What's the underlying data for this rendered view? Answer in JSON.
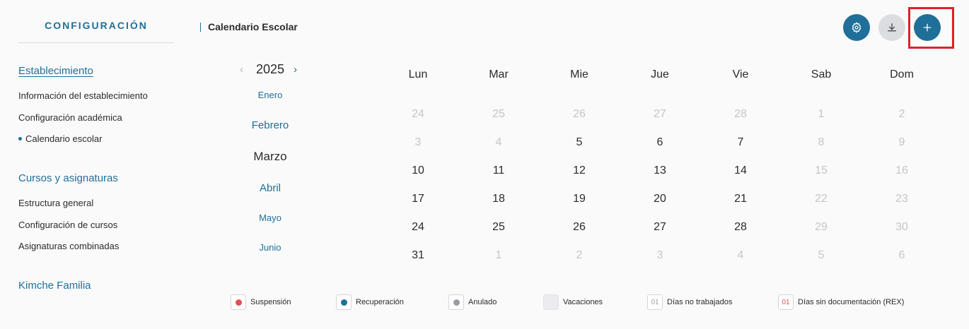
{
  "sidebar": {
    "title": "CONFIGURACIÓN",
    "sections": [
      {
        "heading": "Establecimiento",
        "items": [
          "Información del establecimiento",
          "Configuración académica",
          "Calendario escolar"
        ]
      },
      {
        "heading": "Cursos y asignaturas",
        "items": [
          "Estructura general",
          "Configuración de cursos",
          "Asignaturas combinadas"
        ]
      },
      {
        "heading": "Kimche Familia",
        "items": []
      }
    ]
  },
  "header": {
    "title": "Calendario Escolar",
    "buttons": {
      "settings": "gear-icon",
      "download": "download-icon",
      "add": "plus-icon"
    }
  },
  "year_nav": {
    "prev": "‹",
    "year": "2025",
    "next": "›"
  },
  "months": [
    "Enero",
    "Febrero",
    "Marzo",
    "Abril",
    "Mayo",
    "Junio"
  ],
  "selected_month": "Marzo",
  "calendar": {
    "weekdays": [
      "Lun",
      "Mar",
      "Mie",
      "Jue",
      "Vie",
      "Sab",
      "Dom"
    ],
    "weeks": [
      [
        "24",
        "25",
        "26",
        "27",
        "28",
        "1",
        "2"
      ],
      [
        "3",
        "4",
        "5",
        "6",
        "7",
        "8",
        "9"
      ],
      [
        "10",
        "11",
        "12",
        "13",
        "14",
        "15",
        "16"
      ],
      [
        "17",
        "18",
        "19",
        "20",
        "21",
        "22",
        "23"
      ],
      [
        "24",
        "25",
        "26",
        "27",
        "28",
        "29",
        "30"
      ],
      [
        "31",
        "1",
        "2",
        "3",
        "4",
        "5",
        "6"
      ]
    ],
    "muted": [
      [
        true,
        true,
        true,
        true,
        true,
        true,
        true
      ],
      [
        true,
        true,
        false,
        false,
        false,
        true,
        true
      ],
      [
        false,
        false,
        false,
        false,
        false,
        true,
        true
      ],
      [
        false,
        false,
        false,
        false,
        false,
        true,
        true
      ],
      [
        false,
        false,
        false,
        false,
        false,
        true,
        true
      ],
      [
        false,
        true,
        true,
        true,
        true,
        true,
        true
      ]
    ]
  },
  "legend": {
    "suspension": "Suspensión",
    "recuperacion": "Recuperación",
    "anulado": "Anulado",
    "vacaciones": "Vacaciones",
    "no_trabajados": "Días no trabajados",
    "no_trabajados_sample": "01",
    "sin_documentacion": "Días sin documentación (REX)",
    "sin_documentacion_sample": "01"
  },
  "colors": {
    "primary": "#1f6f99",
    "suspension": "#e05252",
    "recuperacion": "#1f6f99",
    "anulado": "#9a9ca3",
    "rex": "#e05252",
    "highlight": "#e0202a"
  }
}
